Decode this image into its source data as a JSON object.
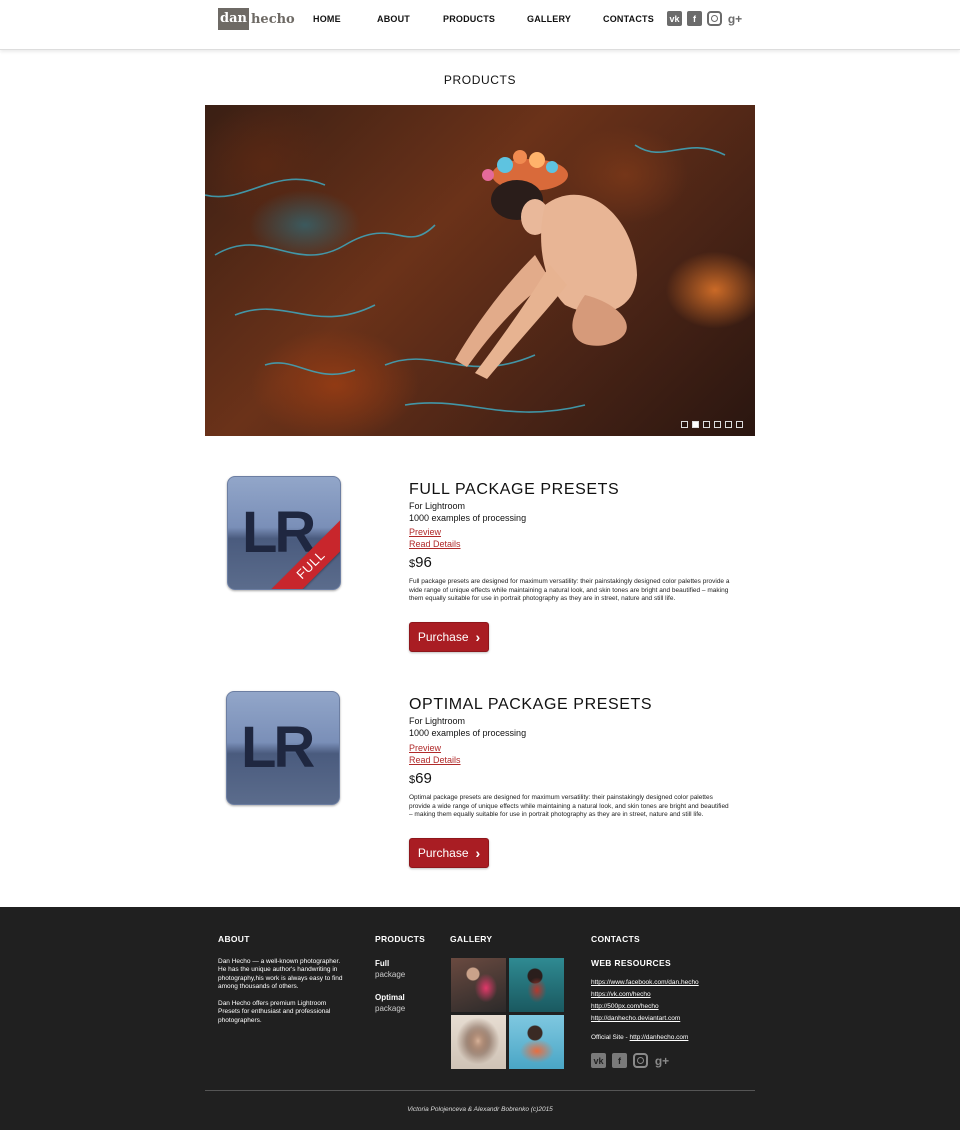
{
  "header": {
    "logo": {
      "part1": "dan",
      "part2": "hecho"
    },
    "nav": [
      "HOME",
      "ABOUT",
      "PRODUCTS",
      "GALLERY",
      "CONTACTS"
    ],
    "social_icons": [
      "vk-icon",
      "facebook-icon",
      "instagram-icon",
      "google-plus-icon"
    ],
    "social_glyphs": {
      "vk": "vk",
      "fb": "f",
      "gplus": "g+"
    }
  },
  "page": {
    "title": "PRODUCTS"
  },
  "slider": {
    "slide_count": 6,
    "active_index": 1
  },
  "products": [
    {
      "title": "FULL PACKAGE PRESETS",
      "subtitle": "For Lightroom",
      "examples": "1000 examples of processing",
      "preview_link": "Preview",
      "details_link": "Read Details",
      "currency": "$",
      "price": "96",
      "icon_text": "LR",
      "ribbon": "FULL",
      "description": "Full package presets are designed for maximum versatility: their painstakingly designed color palettes provide a wide range of unique effects while maintaining a natural look, and skin tones are bright and beautified – making them equally suitable for use in portrait photography as they are in street, nature and still life.",
      "button": "Purchase"
    },
    {
      "title": "OPTIMAL PACKAGE PRESETS",
      "subtitle": "For Lightroom",
      "examples": "1000 examples of processing",
      "preview_link": "Preview",
      "details_link": "Read Details",
      "currency": "$",
      "price": "69",
      "icon_text": "LR",
      "description": "Optimal package presets are designed for maximum versatility: their painstakingly designed color palettes provide a wide range of unique effects while maintaining a natural look, and skin tones are bright and beautified – making them equally suitable for use in portrait photography as they are in street, nature and still life.",
      "button": "Purchase"
    }
  ],
  "footer": {
    "about": {
      "heading": "ABOUT",
      "p1": "Dan Hecho — a well-known photographer. He has the unique author's handwriting in photography,his work is always easy to find among thousands of others.",
      "p2": "Dan Hecho offers premium Lightroom Presets for enthusiast and professional photographers."
    },
    "products": {
      "heading": "PRODUCTS",
      "items": [
        {
          "bold": "Full",
          "normal": "package"
        },
        {
          "bold": "Optimal",
          "normal": "package"
        }
      ]
    },
    "gallery": {
      "heading": "GALLERY"
    },
    "contacts": {
      "heading": "CONTACTS",
      "subheading": "WEB RESOURCES",
      "links": [
        "https://www.facebook.com/dan.hecho",
        "https://vk.com/hecho",
        "http://500px.com/hecho",
        "http://danhecho.deviantart.com"
      ],
      "official_label": "Official Site - ",
      "official_link": "http://danhecho.com"
    },
    "copyright": "Victoria Polojenceva & Alexandr Bobrenko (c)2015"
  },
  "colors": {
    "accent": "#a91d23",
    "footer_bg": "#202020",
    "link": "#b02a2a"
  }
}
